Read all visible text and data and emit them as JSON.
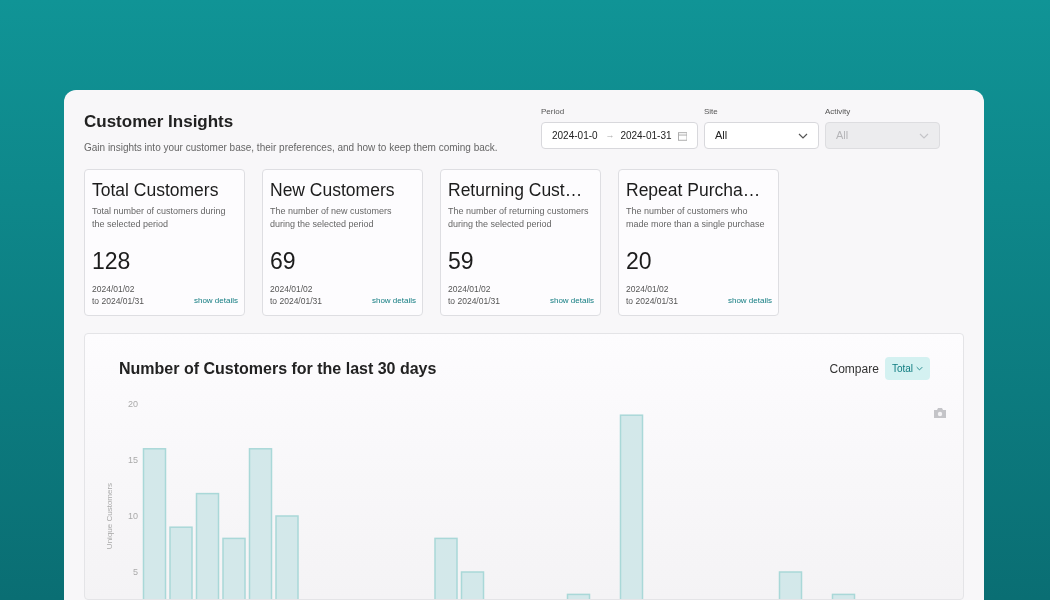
{
  "header": {
    "title": "Customer Insights",
    "subtitle": "Gain insights into your customer base, their preferences, and how to keep them coming back."
  },
  "filters": [
    {
      "kind": "daterange",
      "label": "Period",
      "start": "2024-01-0",
      "separator": "→",
      "end": "2024-01-31",
      "disabled": false
    },
    {
      "kind": "select",
      "label": "Site",
      "value": "All",
      "disabled": false
    },
    {
      "kind": "select",
      "label": "Activity",
      "value": "All",
      "disabled": true
    }
  ],
  "stats": [
    {
      "title": "Total Customers",
      "description": "Total number of customers during the selected period",
      "value": "128",
      "date_from": "2024/01/02",
      "date_to": "to 2024/01/31",
      "link": "show details"
    },
    {
      "title": "New Customers",
      "description": "The number of new customers during the selected period",
      "value": "69",
      "date_from": "2024/01/02",
      "date_to": "to 2024/01/31",
      "link": "show details"
    },
    {
      "title": "Returning Cust…",
      "description": "The number of returning customers during the selected period",
      "value": "59",
      "date_from": "2024/01/02",
      "date_to": "to 2024/01/31",
      "link": "show details"
    },
    {
      "title": "Repeat Purcha…",
      "description": "The number of customers who made more than a single purchase",
      "value": "20",
      "date_from": "2024/01/02",
      "date_to": "to 2024/01/31",
      "link": "show details"
    }
  ],
  "chart_panel": {
    "title": "Number of Customers for the last 30 days",
    "compare_label": "Compare",
    "compare_value": "Total",
    "y_axis_title": "Unique Customers",
    "y_axis_labels": [
      "20",
      "15",
      "10",
      "5"
    ]
  }
}
